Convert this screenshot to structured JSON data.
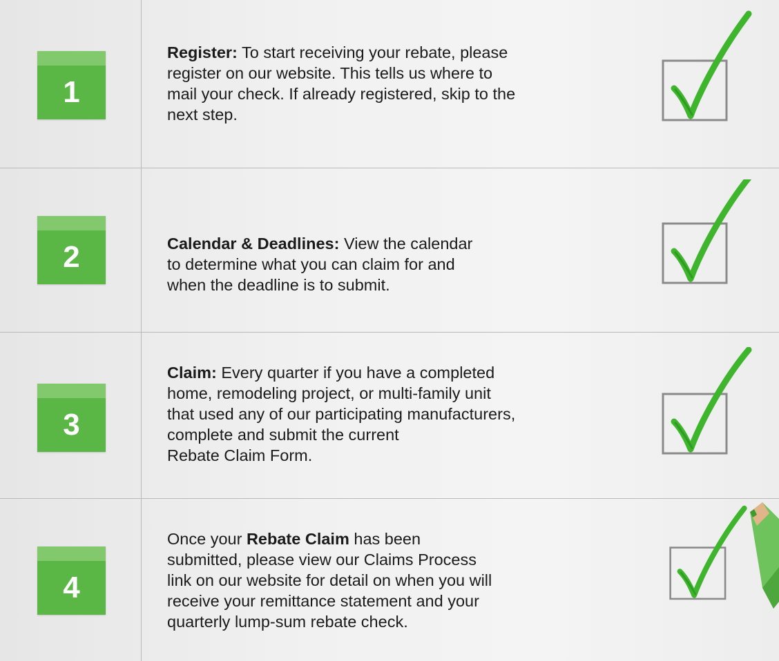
{
  "steps": [
    {
      "number": "1",
      "bold_lead": "Register:",
      "text": " To start receiving your rebate, please\nregister on our website. This tells us where to\nmail your check. If already registered, skip to the\nnext step.",
      "after_bold": ""
    },
    {
      "number": "2",
      "bold_lead": "Calendar & Deadlines:",
      "text": " View the calendar\nto determine what you can claim for and\nwhen the deadline is to submit.",
      "after_bold": ""
    },
    {
      "number": "3",
      "bold_lead": "Claim:",
      "text": " Every quarter if you have a completed\nhome, remodeling project, or multi-family unit\nthat used any of our participating manufacturers,\ncomplete and submit the current\nRebate Claim Form.",
      "after_bold": ""
    },
    {
      "number": "4",
      "pre_bold": "Once your ",
      "bold_lead": "Rebate Claim",
      "text": " has been\nsubmitted, please view our Claims Process\nlink on our website for detail on when you will\nreceive your remittance statement and your\nquarterly lump-sum rebate check."
    }
  ],
  "colors": {
    "number_box": "#5ab746",
    "number_box_band": "#82c96d",
    "check_green": "#3fb52d",
    "box_gray": "#8a8a8a",
    "divider": "#b9b9b9"
  },
  "icons": {
    "check": "green-checkmark-in-box-icon",
    "pencil": "green-pencil-icon"
  }
}
